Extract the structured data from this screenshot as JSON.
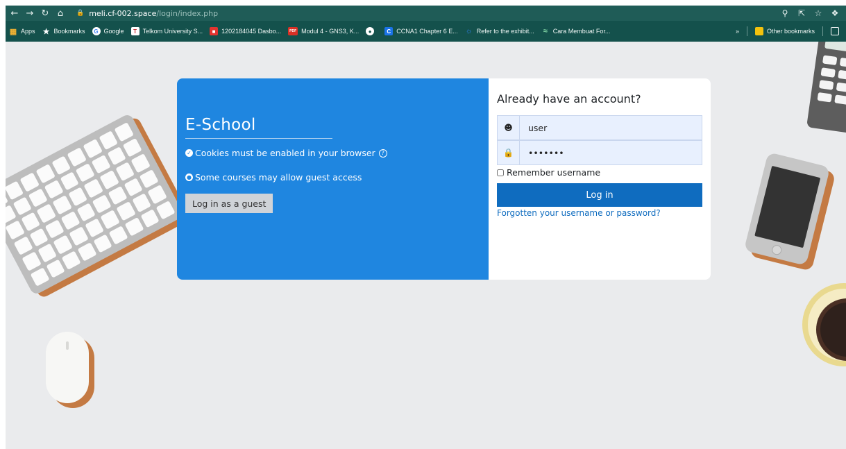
{
  "browser": {
    "url_host": "meli.cf-002.space",
    "url_path": "/login/index.php",
    "bookmarks": [
      {
        "label": "Apps",
        "icon": "apps-grid-icon",
        "color": "#f2b233"
      },
      {
        "label": "Bookmarks",
        "icon": "star-icon",
        "color": "#ffffff"
      },
      {
        "label": "Google",
        "icon": "google-icon",
        "color": "#ffffff"
      },
      {
        "label": "Telkom University S...",
        "icon": "telkom-icon",
        "color": "#c2282e"
      },
      {
        "label": "1202184045 Dasbo...",
        "icon": "dasboard-icon",
        "color": "#e3342f"
      },
      {
        "label": "Modul 4 - GNS3, K...",
        "icon": "pdf-icon",
        "color": "#d93025"
      },
      {
        "label": "",
        "icon": "globe-icon",
        "color": "#ffffff"
      },
      {
        "label": "CCNA1 Chapter 6 E...",
        "icon": "ccna-icon",
        "color": "#1a73e8"
      },
      {
        "label": "Refer to the exhibit...",
        "icon": "quiz-icon",
        "color": "#2f80ed"
      },
      {
        "label": "Cara Membuat For...",
        "icon": "wave-icon",
        "color": "#7fd4a4"
      }
    ],
    "more_label": "»",
    "other_bookmarks_label": "Other bookmarks"
  },
  "login": {
    "site_name": "E-School",
    "cookies_notice": "Cookies must be enabled in your browser",
    "guest_notice": "Some courses may allow guest access",
    "guest_button": "Log in as a guest",
    "account_heading": "Already have an account?",
    "username_value": "user",
    "password_value": "•••••••",
    "remember_label": "Remember username",
    "login_button": "Log in",
    "forgot_link": "Forgotten your username or password?"
  },
  "colors": {
    "chrome_bar": "#1f5c57",
    "bookmark_bar": "#14514c",
    "card_left": "#1f86e0",
    "primary_button": "#0f6cbf",
    "page_background": "#eaebed"
  }
}
